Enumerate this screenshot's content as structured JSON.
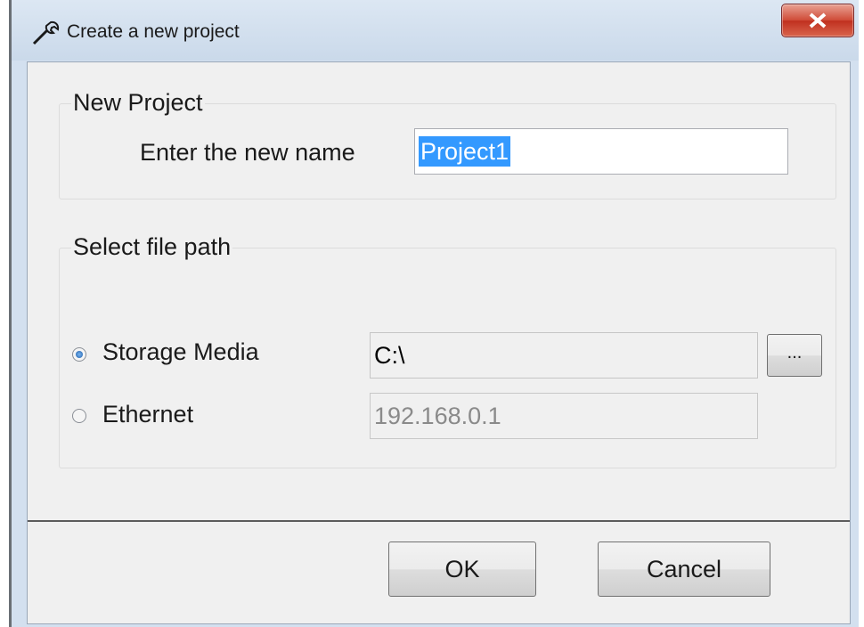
{
  "window": {
    "title": "Create a new project",
    "icon": "wrench-icon",
    "close_icon": "close-icon"
  },
  "new_project": {
    "legend": "New Project",
    "name_label": "Enter the new name",
    "name_value": "Project1"
  },
  "file_path": {
    "legend": "Select file path",
    "storage": {
      "label": "Storage Media",
      "selected": true,
      "path_value": "C:\\",
      "browse_label": "..."
    },
    "ethernet": {
      "label": "Ethernet",
      "selected": false,
      "address_value": "192.168.0.1"
    }
  },
  "buttons": {
    "ok": "OK",
    "cancel": "Cancel"
  },
  "colors": {
    "selection": "#3399ff",
    "close_button": "#c0301f"
  }
}
